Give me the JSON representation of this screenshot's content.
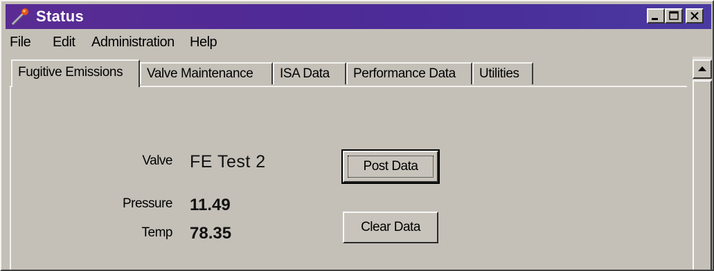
{
  "window": {
    "title": "Status",
    "icon": "status-app-icon",
    "controls": [
      "minimize",
      "maximize",
      "close"
    ]
  },
  "menu": {
    "items": [
      "File",
      "Edit",
      "Administration",
      "Help"
    ]
  },
  "tabs": {
    "items": [
      {
        "label": "Fugitive Emissions",
        "active": true
      },
      {
        "label": "Valve Maintenance",
        "active": false
      },
      {
        "label": "ISA Data",
        "active": false
      },
      {
        "label": "Performance Data",
        "active": false
      },
      {
        "label": "Utilities",
        "active": false
      }
    ]
  },
  "panel": {
    "valve": {
      "label": "Valve",
      "value": "FE Test 2"
    },
    "pressure": {
      "label": "Pressure",
      "value": "11.49"
    },
    "temp": {
      "label": "Temp",
      "value": "78.35"
    },
    "post_button": "Post Data",
    "clear_button": "Clear Data"
  },
  "colors": {
    "titlebar": "#4f2a96",
    "face": "#c4c0b8"
  }
}
